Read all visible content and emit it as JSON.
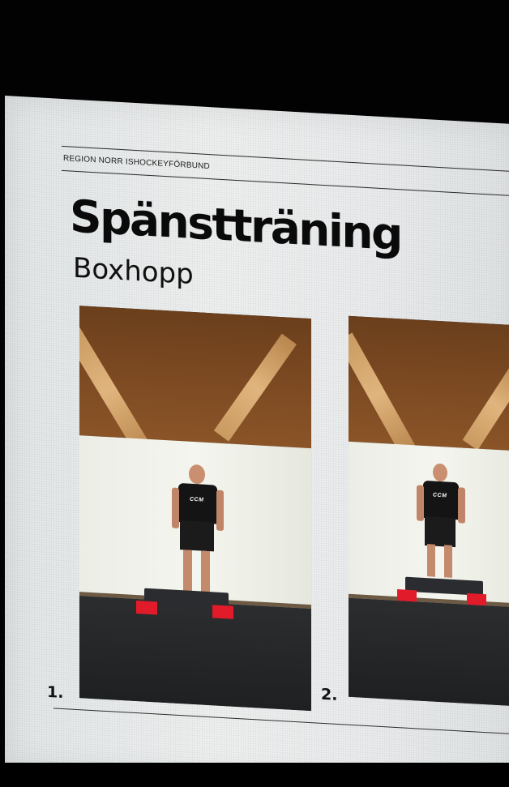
{
  "document": {
    "organization": "REGION NORR ISHOCKEYFÖRBUND",
    "title": "Spänstträning",
    "subtitle": "Boxhopp"
  },
  "figures": [
    {
      "step": "1.",
      "shirt_logo": "CCM"
    },
    {
      "step": "2.",
      "shirt_logo": "CCM"
    }
  ],
  "colors": {
    "page": "#eceeee",
    "text": "#0a0a0a",
    "box_legs": "#e21b2a",
    "ceiling_wood": "#7a4821",
    "floor": "#2b2d2f"
  }
}
